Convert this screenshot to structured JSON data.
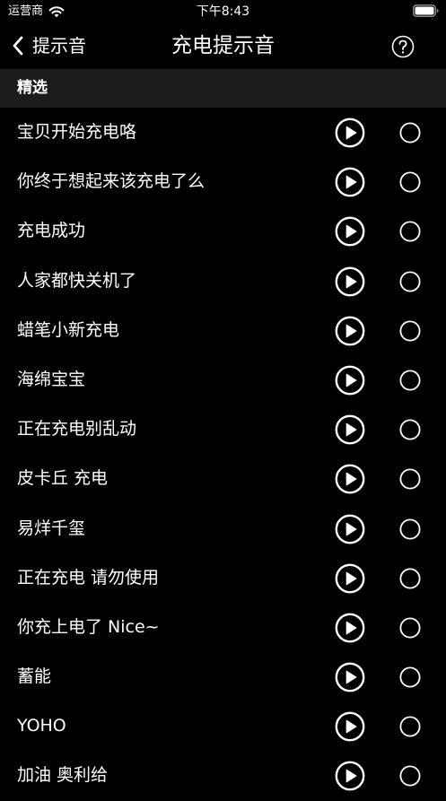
{
  "status_bar": {
    "carrier": "运营商",
    "time": "下午8:43",
    "icons": [
      "wifi-icon",
      "battery-icon"
    ]
  },
  "nav": {
    "back_label": "提示音",
    "title": "充电提示音",
    "help_icon": "question-circle-icon"
  },
  "section": {
    "title": "精选"
  },
  "sounds": [
    {
      "name": "宝贝开始充电咯"
    },
    {
      "name": "你终于想起来该充电了么"
    },
    {
      "name": "充电成功"
    },
    {
      "name": "人家都快关机了"
    },
    {
      "name": "蜡笔小新充电"
    },
    {
      "name": "海绵宝宝"
    },
    {
      "name": "正在充电别乱动"
    },
    {
      "name": "皮卡丘 充电"
    },
    {
      "name": "易烊千玺"
    },
    {
      "name": "正在充电 请勿使用"
    },
    {
      "name": "你充上电了 Nice~"
    },
    {
      "name": "蓄能"
    },
    {
      "name": "YOHO"
    },
    {
      "name": "加油 奥利给"
    }
  ],
  "colors": {
    "background": "#000000",
    "section_background": "#1c1c1e",
    "foreground": "#ffffff"
  }
}
